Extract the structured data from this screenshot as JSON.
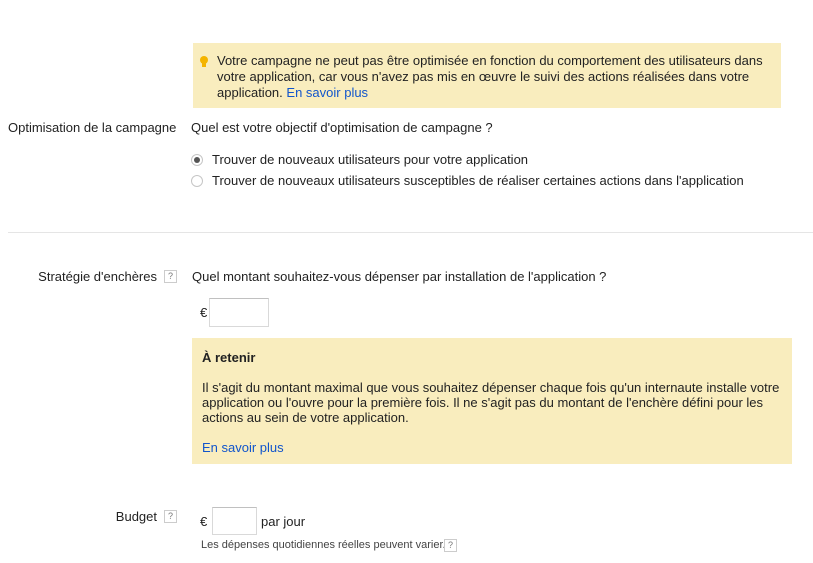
{
  "warning": {
    "text": "Votre campagne ne peut pas être optimisée en fonction du comportement des utilisateurs dans votre application, car vous n'avez pas mis en œuvre le suivi des actions réalisées dans votre application.",
    "link": "En savoir plus"
  },
  "optimization": {
    "label": "Optimisation de la campagne",
    "question": "Quel est votre objectif d'optimisation de campagne ?",
    "options": [
      {
        "label": "Trouver de nouveaux utilisateurs pour votre application",
        "selected": true
      },
      {
        "label": "Trouver de nouveaux utilisateurs susceptibles de réaliser certaines actions dans l'application",
        "selected": false
      }
    ]
  },
  "bidding": {
    "label": "Stratégie d'enchères",
    "help": "?",
    "question": "Quel montant souhaitez-vous dépenser par installation de l'application ?",
    "currency": "€",
    "value": ""
  },
  "retain": {
    "title": "À retenir",
    "body": "Il s'agit du montant maximal que vous souhaitez dépenser chaque fois qu'un internaute installe votre application ou l'ouvre pour la première fois. Il ne s'agit pas du montant de l'enchère défini pour les actions au sein de votre application.",
    "link": "En savoir plus"
  },
  "budget": {
    "label": "Budget",
    "help": "?",
    "currency": "€",
    "value": "",
    "unit": "par jour",
    "note": "Les dépenses quotidiennes réelles peuvent varier.",
    "note_help": "?"
  }
}
